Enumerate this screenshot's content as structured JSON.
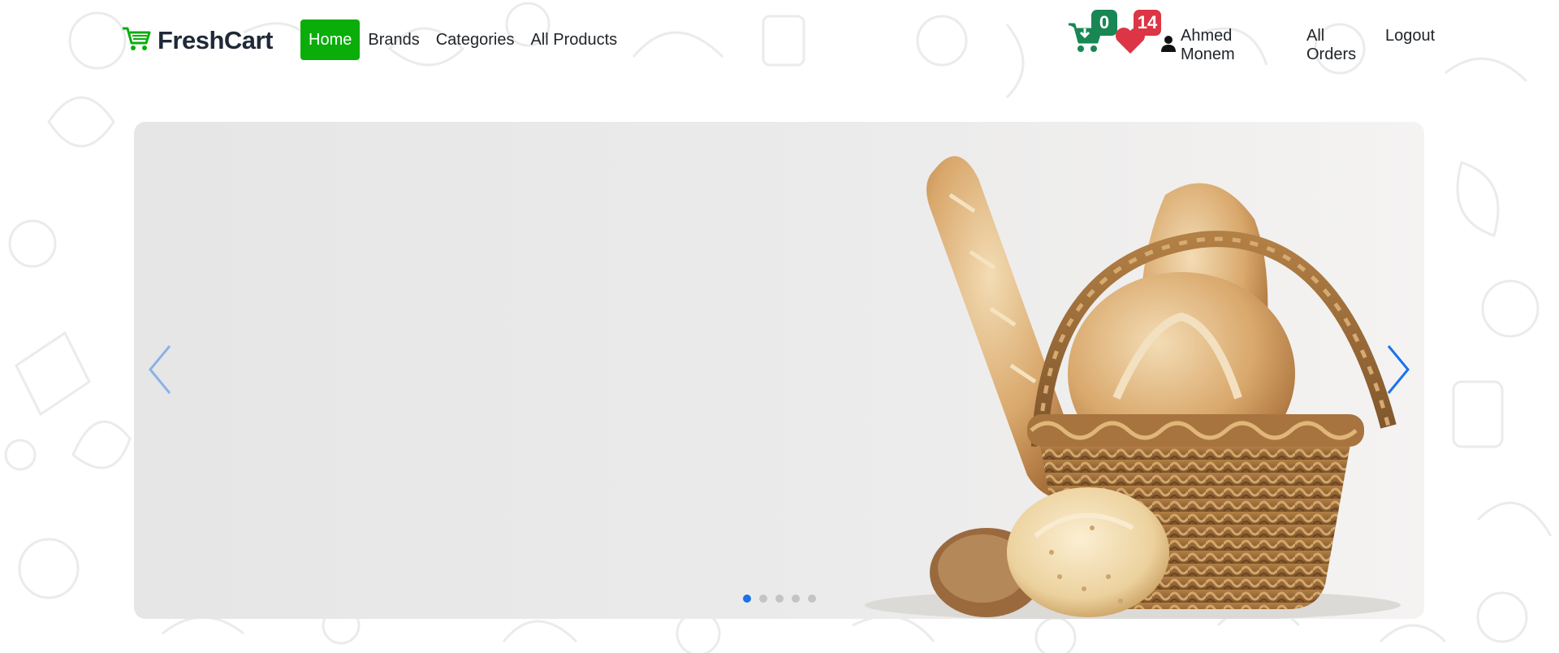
{
  "brand": {
    "name": "FreshCart",
    "icon": "shopping-cart-icon",
    "color": "#0aad0a"
  },
  "nav": {
    "links": [
      {
        "label": "Home",
        "active": true
      },
      {
        "label": "Brands",
        "active": false
      },
      {
        "label": "Categories",
        "active": false
      },
      {
        "label": "All Products",
        "active": false
      }
    ]
  },
  "header_right": {
    "cart": {
      "icon": "cart-download-icon",
      "count": "0",
      "color": "#198754"
    },
    "wishlist": {
      "icon": "heart-icon",
      "count": "14",
      "color": "#dc3545"
    },
    "user": {
      "icon": "user-icon",
      "name": "Ahmed Monem"
    },
    "orders_label": "All Orders",
    "logout_label": "Logout"
  },
  "slider": {
    "slide_subject": "bread-basket-image",
    "active_index": 0,
    "dot_count": 5,
    "prev_icon": "chevron-left-icon",
    "next_icon": "chevron-right-icon",
    "accent": "#1a73e8"
  }
}
